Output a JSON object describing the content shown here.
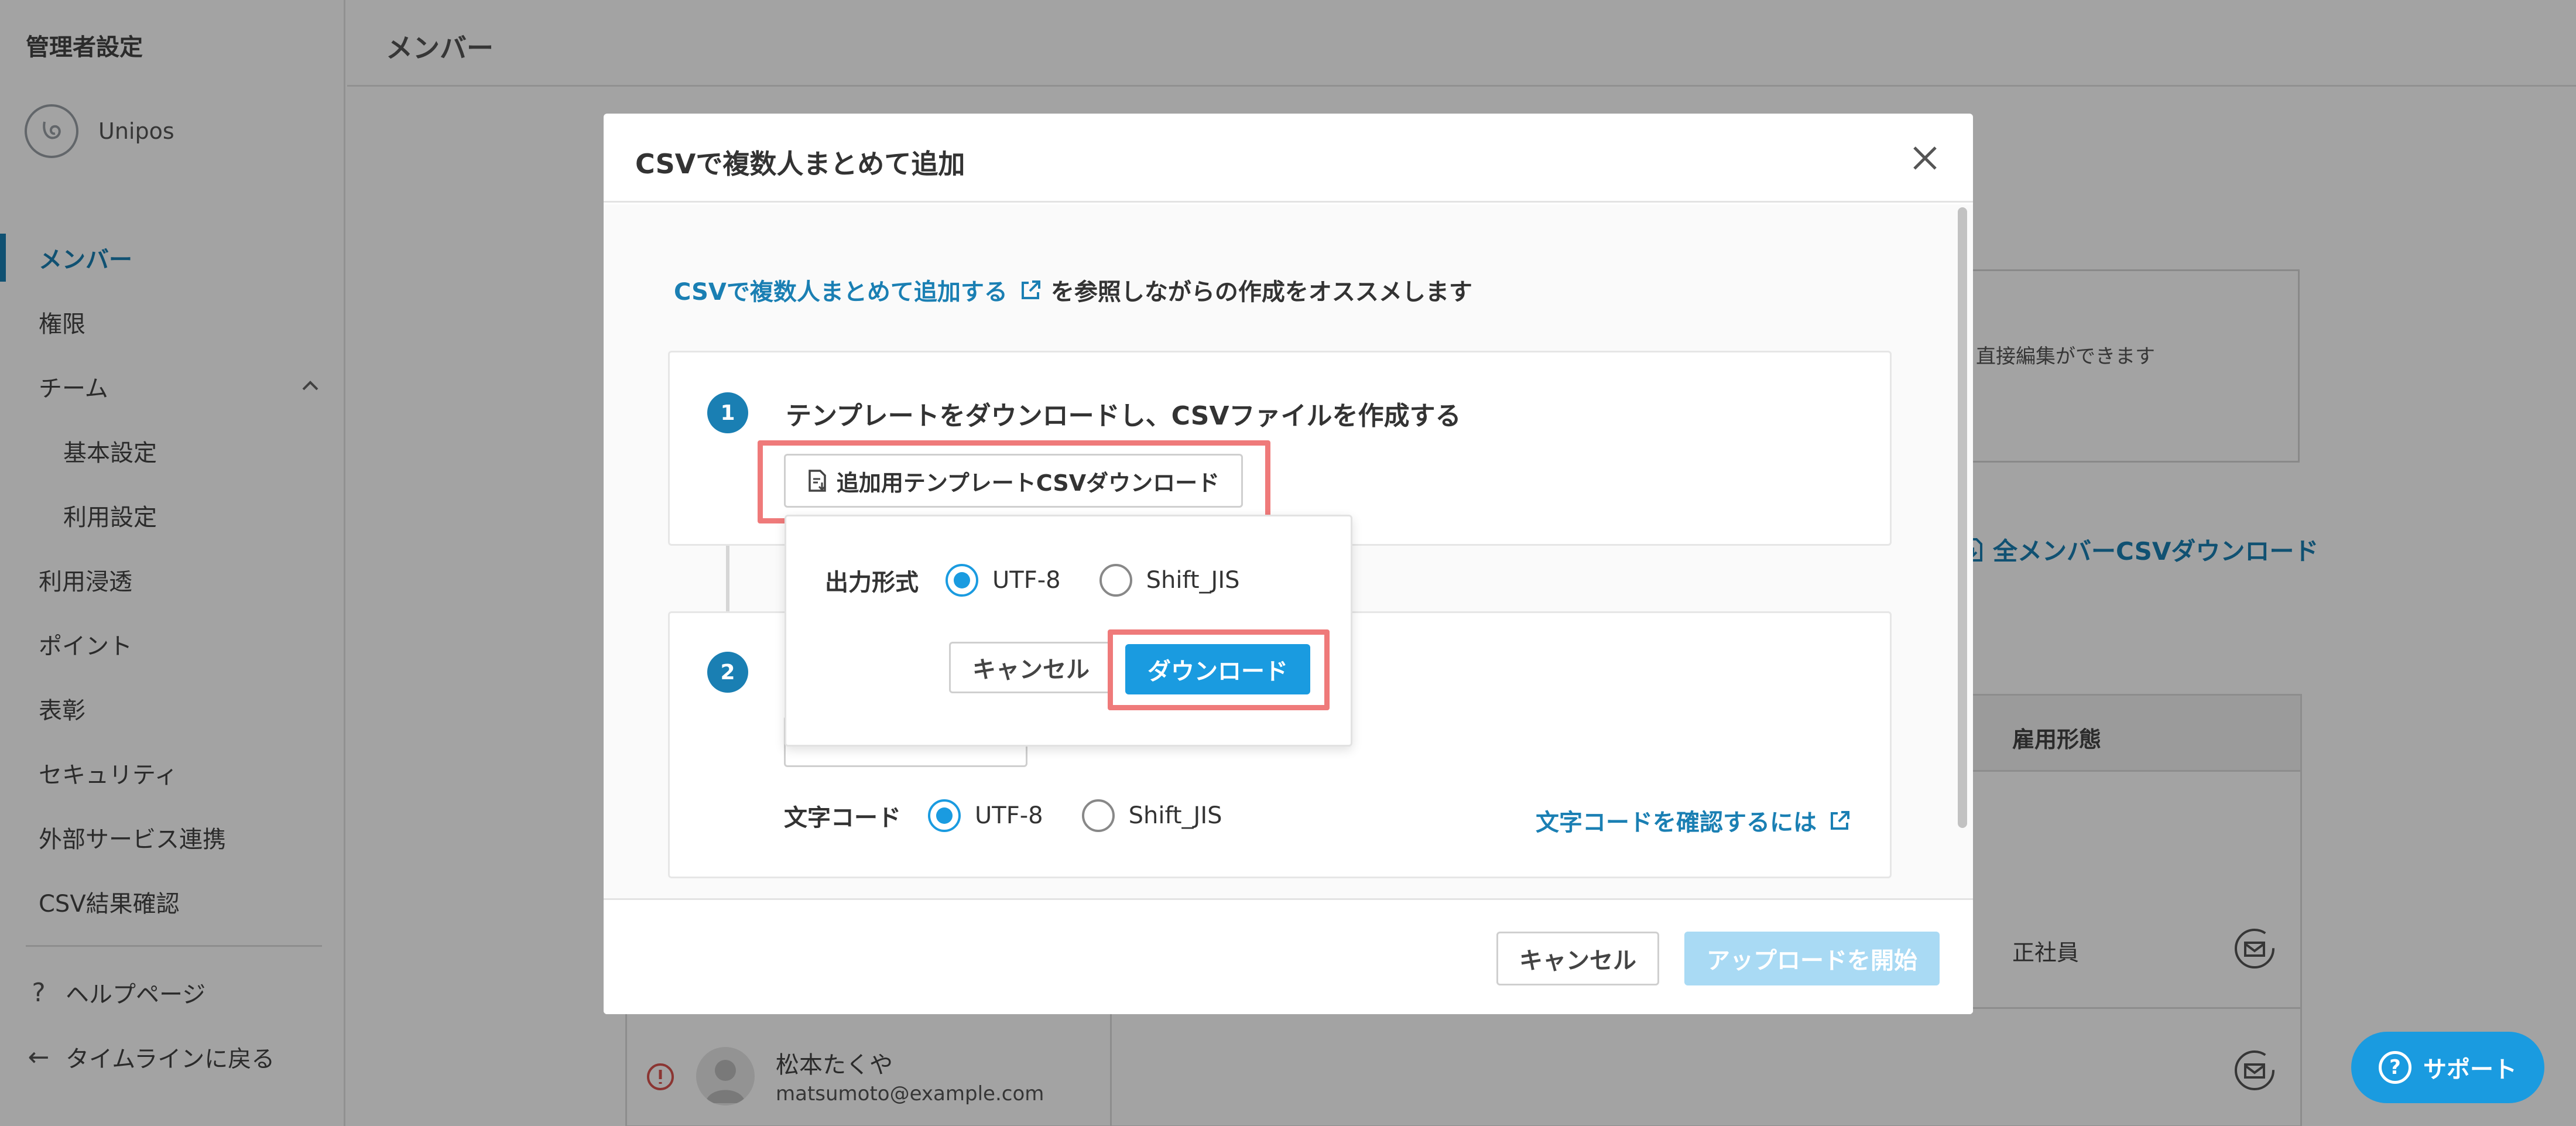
{
  "sidebar": {
    "title": "管理者設定",
    "logo_text": "Unipos",
    "items": [
      {
        "label": "メンバー"
      },
      {
        "label": "権限"
      },
      {
        "label": "チーム"
      },
      {
        "label": "基本設定"
      },
      {
        "label": "利用設定"
      },
      {
        "label": "利用浸透"
      },
      {
        "label": "ポイント"
      },
      {
        "label": "表彰"
      },
      {
        "label": "セキュリティ"
      },
      {
        "label": "外部サービス連携"
      },
      {
        "label": "CSV結果確認"
      }
    ],
    "bottom": [
      {
        "label": "ヘルプページ"
      },
      {
        "label": "タイムラインに戻る"
      }
    ]
  },
  "header": {
    "title": "メンバー"
  },
  "background": {
    "box_text": "直接編集ができます",
    "all_download": "全メンバーCSVダウンロード",
    "table_header_employment": "雇用形態",
    "row1_employment": "正社員",
    "row2_name": "松本たくや",
    "row2_email": "matsumoto@example.com"
  },
  "support": {
    "label": "サポート"
  },
  "modal": {
    "title": "CSVで複数人まとめて追加",
    "ref_link": "CSVで複数人まとめて追加する",
    "ref_rest": "を参照しながらの作成をオススメします",
    "step1": {
      "num": "1",
      "title": "テンプレートをダウンロードし、CSVファイルを作成する",
      "template_button": "追加用テンプレートCSVダウンロード"
    },
    "step2": {
      "num": "2",
      "encoding_label": "文字コード",
      "options": [
        "UTF-8",
        "Shift_JIS"
      ],
      "selected": "UTF-8",
      "check_link": "文字コードを確認するには"
    },
    "popover": {
      "format_label": "出力形式",
      "options": [
        "UTF-8",
        "Shift_JIS"
      ],
      "selected": "UTF-8",
      "cancel": "キャンセル",
      "download": "ダウンロード"
    },
    "footer": {
      "cancel": "キャンセル",
      "upload": "アップロードを開始"
    }
  },
  "colors": {
    "accent": "#1a9be0",
    "link": "#1a7fb3",
    "highlight": "#ef7a7a",
    "upload_disabled": "#a9daf4"
  }
}
